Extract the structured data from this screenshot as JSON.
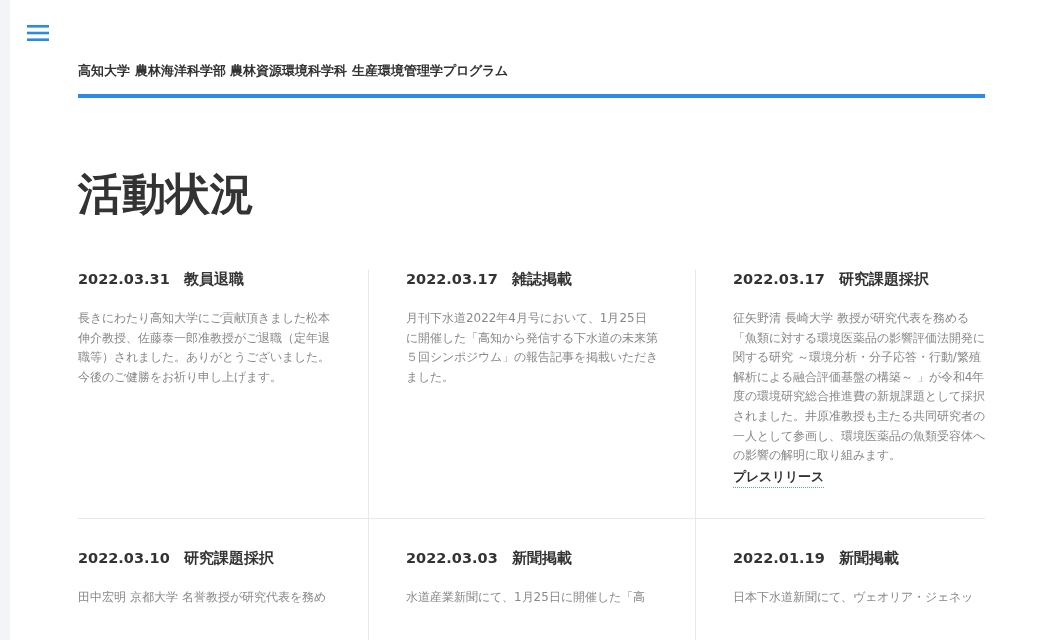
{
  "header": {
    "site_title": "高知大学 農林海洋科学部 農林資源環境科学科 生産環境管理学プログラム"
  },
  "page_title": "活動状況",
  "posts": [
    {
      "date": "2022.03.31",
      "category": "教員退職",
      "body": "長きにわたり高知大学にご貢献頂きました松本伸介教授、佐藤泰一郎准教授がご退職（定年退職等）されました。ありがとうございました。今後のご健勝をお祈り申し上げます。"
    },
    {
      "date": "2022.03.17",
      "category": "雑誌掲載",
      "body": "月刊下水道2022年4月号において、1月25日に開催した「高知から発信する下水道の未来第５回シンポジウム」の報告記事を掲載いただきました。"
    },
    {
      "date": "2022.03.17",
      "category": "研究課題採択",
      "body": "征矢野清 長崎大学 教授が研究代表を務める「魚類に対する環境医薬品の影響評価法開発に関する研究 ～環境分析・分子応答・行動/繁殖解析による融合評価基盤の構築～ 」が令和4年度の環境研究総合推進費の新規課題として採択されました。井原准教授も主たる共同研究者の一人として参画し、環境医薬品の魚類受容体への影響の解明に取り組みます。",
      "link": "プレスリリース"
    },
    {
      "date": "2022.03.10",
      "category": "研究課題採択",
      "body": "田中宏明 京都大学 名誉教授が研究代表を務め"
    },
    {
      "date": "2022.03.03",
      "category": "新聞掲載",
      "body": "水道産業新聞にて、1月25日に開催した「高"
    },
    {
      "date": "2022.01.19",
      "category": "新聞掲載",
      "body": "日本下水道新聞にて、ヴェオリア・ジェネッ"
    }
  ]
}
